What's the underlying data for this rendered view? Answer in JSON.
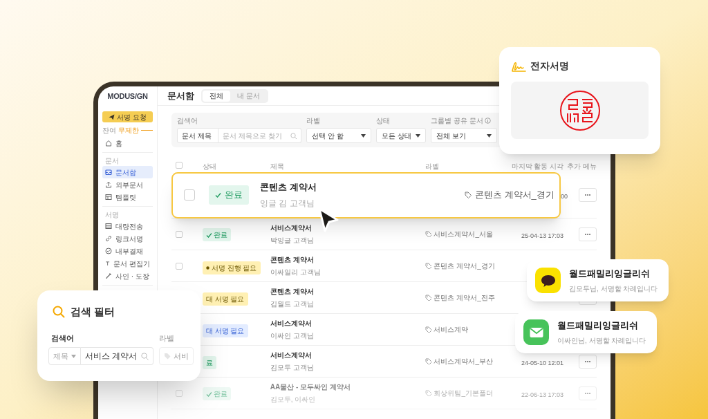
{
  "app": {
    "logo": "MODUS/GN",
    "header_title": "문서함",
    "tabs": [
      {
        "label": "전체",
        "selected": true
      },
      {
        "label": "내 문서",
        "selected": false
      }
    ]
  },
  "sidebar": {
    "request_button": "서명 요청",
    "remaining_label": "잔여",
    "remaining_value": "무제한",
    "sections": [
      {
        "items": [
          {
            "label": "홈",
            "selected": false
          }
        ]
      },
      {
        "heading": "문서",
        "items": [
          {
            "label": "문서함",
            "selected": true
          },
          {
            "label": "외부문서",
            "selected": false
          },
          {
            "label": "템플릿",
            "selected": false
          }
        ]
      },
      {
        "heading": "서명",
        "items": [
          {
            "label": "대량전송",
            "selected": false
          },
          {
            "label": "링크서명",
            "selected": false
          },
          {
            "label": "내부결재",
            "selected": false
          },
          {
            "label": "문서 편집기",
            "selected": false
          },
          {
            "label": "사인 · 도장",
            "selected": false
          }
        ]
      }
    ]
  },
  "filters": [
    {
      "kind": "search",
      "label": "검색어",
      "select": "문서 제목",
      "placeholder": "문서 제목으로 찾기"
    },
    {
      "kind": "select",
      "label": "라벨",
      "value": "선택 안 함"
    },
    {
      "kind": "select",
      "label": "상태",
      "value": "모든 상태"
    },
    {
      "kind": "select",
      "label": "그룹별 공유 문서",
      "info": true,
      "value": "전체 보기"
    }
  ],
  "table": {
    "select_all_checked": false,
    "columns": [
      "상태",
      "제목",
      "라벨",
      "마지막 활동 시각",
      "추가 메뉴"
    ],
    "rows": [
      {
        "checked": false,
        "highlighted": true,
        "faded": false,
        "status": {
          "kind": "done",
          "text": "완료",
          "icon": true
        },
        "title": "콘텐츠 계약서",
        "recipient": "잉글 김 고객님",
        "label": "콘텐츠 계약서_경기",
        "time": "00"
      },
      {
        "checked": false,
        "highlighted": false,
        "faded": false,
        "status": {
          "kind": "done",
          "text": "완료",
          "icon": true
        },
        "title": "서비스계약서",
        "recipient": "박잉글 고객님",
        "label": "서비스계약서_서울",
        "time": "25-04-13 17:03"
      },
      {
        "checked": false,
        "highlighted": false,
        "faded": false,
        "status": {
          "kind": "pending",
          "text": "서명 진행 필요",
          "icon": true
        },
        "title": "콘텐츠 계약서",
        "recipient": "이싸일리 고객님",
        "label": "콘텐츠 계약서_경기"
      },
      {
        "highlighted": false,
        "faded": false,
        "status": {
          "kind": "pending",
          "text": "대 서명 필요",
          "icon": false
        },
        "title": "콘텐츠 계약서",
        "recipient": "김월드 고객님",
        "label": "콘텐츠 계약서_전주"
      },
      {
        "highlighted": false,
        "faded": false,
        "status": {
          "kind": "waiting",
          "text": "대 서명 필요",
          "icon": false
        },
        "title": "서비스계약서",
        "recipient": "이싸인 고객님",
        "label": "서비스계약"
      },
      {
        "highlighted": false,
        "faded": false,
        "status": {
          "kind": "done",
          "text": "료",
          "icon": false
        },
        "title": "서비스계약서",
        "recipient": "김모두 고객님",
        "label": "서비스계약서_부산",
        "time": "24-05-10 12:01"
      },
      {
        "checked": false,
        "highlighted": false,
        "faded": true,
        "status": {
          "kind": "done",
          "text": "완료",
          "icon": true
        },
        "title": "AA물산 - 모두싸인 계약서",
        "recipient": "김모두, 이싸인",
        "label": "회상위팀_기본폴더",
        "time": "22-06-13 17:03"
      }
    ]
  },
  "signature_card": {
    "title": "전자서명"
  },
  "filter_card": {
    "title": "검색 필터",
    "keyword_label": "검색어",
    "select": "제목",
    "value": "서비스 계약서",
    "label_heading": "라벨",
    "label_value": "서비"
  },
  "notifications": [
    {
      "kind": "kakao",
      "title": "월드패밀리잉글리쉬",
      "message": "김모두님, 서명할 차례입니다"
    },
    {
      "kind": "mail",
      "title": "월드패밀리잉글리쉬",
      "message": "이싸인님, 서명할 차례입니다"
    }
  ]
}
